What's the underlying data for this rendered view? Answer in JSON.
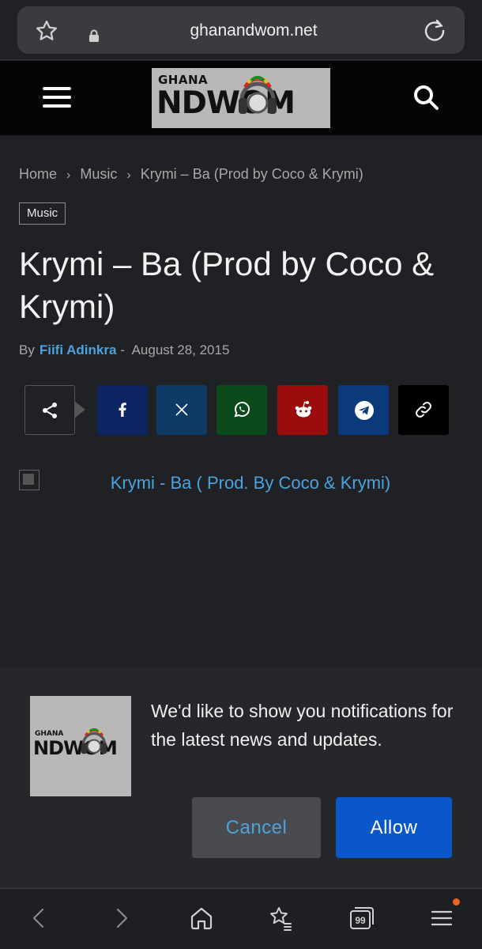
{
  "browser": {
    "url": "ghanandwom.net"
  },
  "site": {
    "logo_top": "GHANA",
    "logo_bottom": "NDWOM"
  },
  "breadcrumb": {
    "items": [
      "Home",
      "Music",
      "Krymi – Ba (Prod by Coco & Krymi)"
    ],
    "separator": "›"
  },
  "article": {
    "category": "Music",
    "title": "Krymi – Ba (Prod by Coco & Krymi)",
    "by_label": "By",
    "author": "Fiifi Adinkra",
    "date_sep": "-",
    "date": "August 28, 2015",
    "image_alt": "Krymi - Ba ( Prod. By Coco & Krymi)"
  },
  "share": {
    "buttons": [
      {
        "name": "facebook",
        "color": "#0e2563"
      },
      {
        "name": "x",
        "color": "#0e3a66"
      },
      {
        "name": "whatsapp",
        "color": "#0b4a1a"
      },
      {
        "name": "reddit",
        "color": "#9b0c0c"
      },
      {
        "name": "telegram",
        "color": "#0a3a7a"
      },
      {
        "name": "copy-link",
        "color": "#000000"
      }
    ]
  },
  "notification": {
    "message": "We'd like to show you notifications for the latest news and updates.",
    "logo_top": "GHANA",
    "logo_bottom": "NDWOM",
    "cancel_label": "Cancel",
    "allow_label": "Allow"
  },
  "bottom_nav": {
    "tabs_count": "99",
    "items": [
      "back-icon",
      "forward-icon",
      "home-icon",
      "bookmarks-icon",
      "tabs-icon",
      "menu-icon"
    ]
  },
  "colors": {
    "accent_link": "#4aa3df",
    "allow_button": "#0a57c9",
    "menu_badge": "#f0641e"
  }
}
